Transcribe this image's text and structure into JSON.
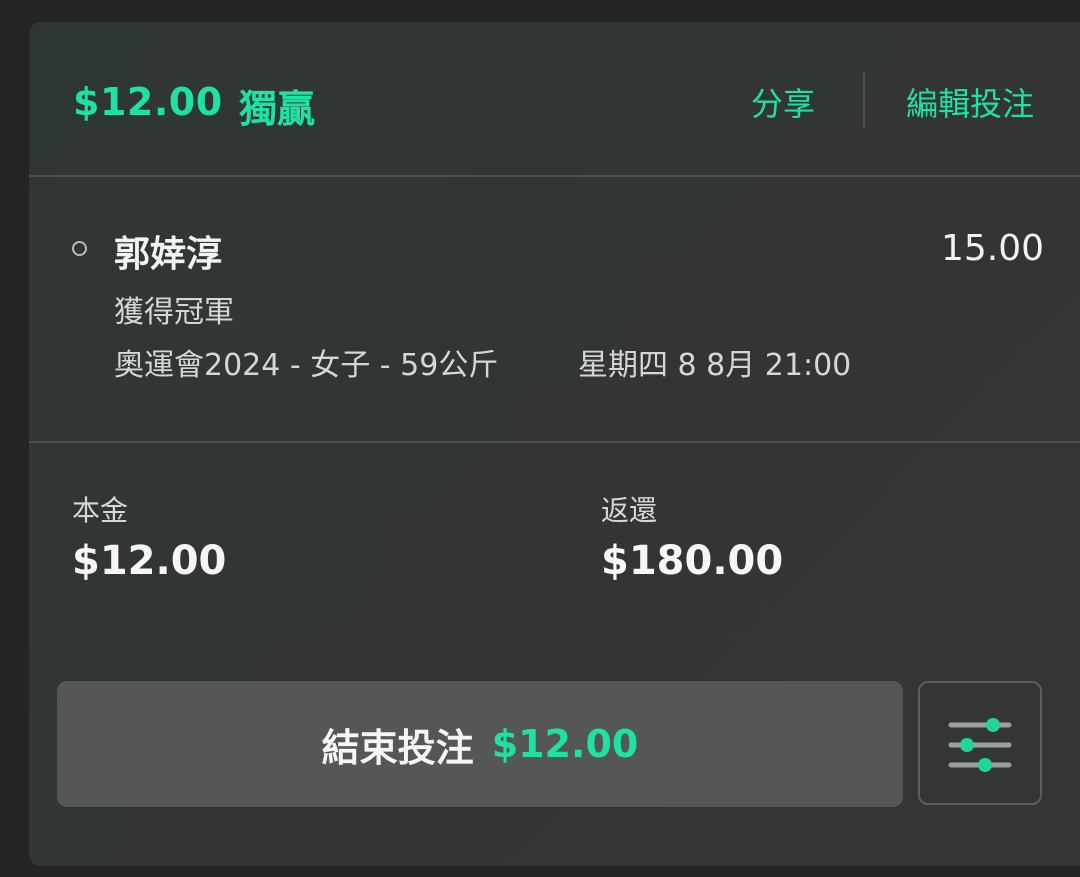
{
  "bet": {
    "amount": "$12.00",
    "type": "獨贏",
    "share_label": "分享",
    "edit_label": "編輯投注"
  },
  "selection": {
    "name": "郭婞淳",
    "odds": "15.00",
    "market": "獲得冠軍",
    "event": "奧運會2024 - 女子 - 59公斤",
    "time": "星期四 8 8月 21:00"
  },
  "summary": {
    "stake_label": "本金",
    "stake_value": "$12.00",
    "return_label": "返還",
    "return_value": "$180.00"
  },
  "cashout": {
    "label": "結束投注",
    "amount": "$12.00"
  },
  "icons": {
    "status": "radio-circle-icon",
    "settings": "sliders-icon"
  },
  "colors": {
    "accent": "#1fe0a6",
    "card": "#323533",
    "button": "#545756"
  }
}
